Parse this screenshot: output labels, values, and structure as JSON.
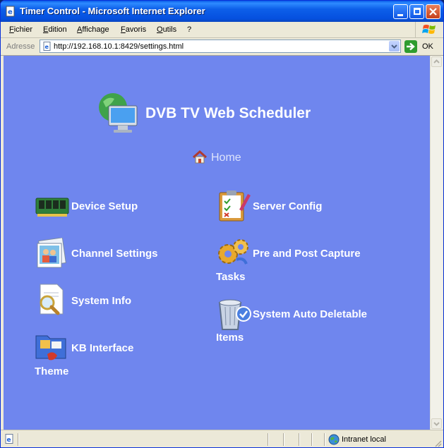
{
  "window": {
    "title": "Timer Control - Microsoft Internet Explorer"
  },
  "menu": [
    "Fichier",
    "Edition",
    "Affichage",
    "Favoris",
    "Outils",
    "?"
  ],
  "address": {
    "label": "Adresse",
    "url": "http://192.168.10.1:8429/settings.html",
    "go_label": "OK"
  },
  "page": {
    "title": "DVB TV Web Scheduler",
    "home": "Home",
    "links": {
      "device_setup": "Device Setup",
      "channel_settings": "Channel Settings",
      "system_info": "System Info",
      "kb_interface_theme": "KB Interface Theme",
      "server_config": "Server Config",
      "pre_post_capture": "Pre and Post Capture Tasks",
      "auto_deletable": "System Auto Deletable Items"
    }
  },
  "status": {
    "zone": "Intranet local"
  },
  "icons": {
    "title": "monitor-globe-icon",
    "home": "house-icon",
    "device_setup": "memory-card-icon",
    "channel_settings": "photo-people-icon",
    "system_info": "magnifier-document-icon",
    "kb_interface_theme": "folder-theme-icon",
    "server_config": "clipboard-checklist-icon",
    "pre_post_capture": "gears-icon",
    "auto_deletable": "recycle-bin-icon"
  }
}
